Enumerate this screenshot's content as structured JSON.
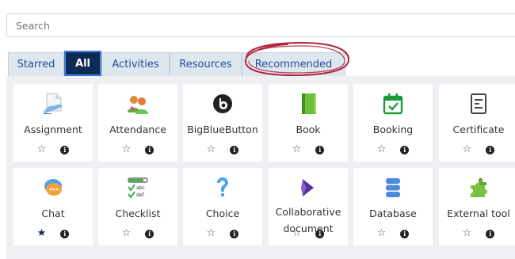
{
  "search": {
    "placeholder": "Search",
    "value": ""
  },
  "tabs": [
    {
      "label": "Starred",
      "active": false
    },
    {
      "label": "All",
      "active": true
    },
    {
      "label": "Activities",
      "active": false
    },
    {
      "label": "Resources",
      "active": false
    },
    {
      "label": "Recommended",
      "active": false
    }
  ],
  "annotation": {
    "color": "#b0263e",
    "shape": "hand-drawn-ellipse"
  },
  "modules": [
    {
      "label": "Assignment",
      "icon": "assignment-icon",
      "starred": false
    },
    {
      "label": "Attendance",
      "icon": "attendance-icon",
      "starred": false
    },
    {
      "label": "BigBlueButton",
      "icon": "bigbluebutton-icon",
      "starred": false
    },
    {
      "label": "Book",
      "icon": "book-icon",
      "starred": false
    },
    {
      "label": "Booking",
      "icon": "booking-icon",
      "starred": false
    },
    {
      "label": "Certificate",
      "icon": "certificate-icon",
      "starred": false
    },
    {
      "label": "Chat",
      "icon": "chat-icon",
      "starred": true
    },
    {
      "label": "Checklist",
      "icon": "checklist-icon",
      "starred": false
    },
    {
      "label": "Choice",
      "icon": "choice-icon",
      "starred": false
    },
    {
      "label": "Collaborative document",
      "icon": "collaborative-document-icon",
      "starred": false
    },
    {
      "label": "Database",
      "icon": "database-icon",
      "starred": false
    },
    {
      "label": "External tool",
      "icon": "external-tool-icon",
      "starred": false
    }
  ],
  "symbols": {
    "star_empty": "☆",
    "star_filled": "★",
    "info": "i"
  },
  "colors": {
    "active_tab": "#102a56",
    "tab_text": "#1f4e9e",
    "tab_bg": "#dfe7ee"
  }
}
